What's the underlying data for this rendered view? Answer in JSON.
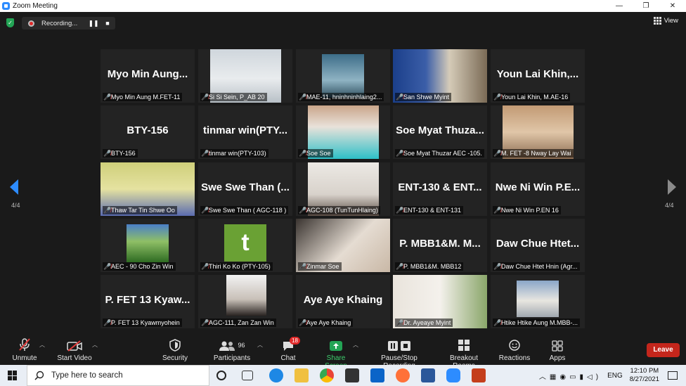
{
  "window": {
    "title": "Zoom Meeting",
    "controls": [
      "—",
      "❐",
      "✕"
    ]
  },
  "topbar": {
    "recording_text": "Recording...",
    "view_label": "View"
  },
  "tiles": [
    {
      "name": "Myo Min Aung M.FET-11",
      "display": "Myo Min Aung..."
    },
    {
      "name": "Si Si Sein, P_AB 20",
      "display": ""
    },
    {
      "name": "MAE-11, hninhninhlaing2...",
      "display": ""
    },
    {
      "name": "San Shwe Myint",
      "display": ""
    },
    {
      "name": "Youn Lai Khin, M.AE-16",
      "display": "Youn Lai Khin,..."
    },
    {
      "name": "BTY-156",
      "display": "BTY-156"
    },
    {
      "name": "tinmar win(PTY-103)",
      "display": "tinmar win(PTY..."
    },
    {
      "name": "Soe Soe",
      "display": ""
    },
    {
      "name": "Soe Myat Thuzar AEC -105.",
      "display": "Soe Myat Thuza..."
    },
    {
      "name": "M. FET -8 Nway Lay Wai",
      "display": ""
    },
    {
      "name": "Thaw Tar Tin Shwe Oo",
      "display": ""
    },
    {
      "name": "Swe Swe Than ( AGC-118 )",
      "display": "Swe Swe Than (..."
    },
    {
      "name": "AGC-108 (TunTunHlaing)",
      "display": ""
    },
    {
      "name": "ENT-130 & ENT-131",
      "display": "ENT-130 & ENT..."
    },
    {
      "name": "Nwe Ni Win P.EN 16",
      "display": "Nwe Ni Win P.E..."
    },
    {
      "name": "AEC - 90 Cho Zin Win",
      "display": ""
    },
    {
      "name": "Thiri Ko Ko (PTY-105)",
      "display": ""
    },
    {
      "name": "Zinmar Soe",
      "display": ""
    },
    {
      "name": "P. MBB1&M. MBB12",
      "display": "P. MBB1&M. M..."
    },
    {
      "name": "Daw Chue Htet Hnin (Agr...",
      "display": "Daw Chue Htet..."
    },
    {
      "name": "P. FET 13 Kyawmyohein",
      "display": "P. FET 13 Kyaw..."
    },
    {
      "name": "AGC-111, Zan Zan Win",
      "display": ""
    },
    {
      "name": "Aye Aye Khaing",
      "display": "Aye Aye Khaing"
    },
    {
      "name": "Dr. Ayeaye Myint",
      "display": ""
    },
    {
      "name": "Htike Htike Aung M.MBB-...",
      "display": ""
    }
  ],
  "avatar_letter": "t",
  "pagination": {
    "left": "4/4",
    "right": "4/4"
  },
  "toolbar": {
    "unmute": "Unmute",
    "start_video": "Start Video",
    "security": "Security",
    "participants": "Participants",
    "participants_count": "96",
    "chat": "Chat",
    "chat_badge": "18",
    "share_screen": "Share Screen",
    "pause_recording": "Pause/Stop Recording",
    "breakout_rooms": "Breakout Rooms",
    "reactions": "Reactions",
    "apps": "Apps",
    "leave": "Leave"
  },
  "taskbar": {
    "search_placeholder": "Type here to search",
    "language": "ENG",
    "time": "12:10 PM",
    "date": "8/27/2021"
  },
  "colors": {
    "accent": "#2d8cff",
    "leave": "#c4261c",
    "share": "#23a455",
    "muted": "#e23b3b"
  }
}
